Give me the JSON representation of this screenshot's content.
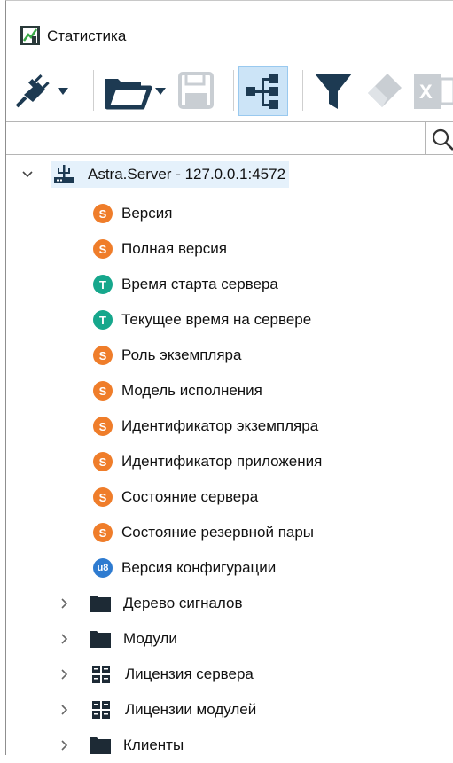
{
  "window": {
    "title": "Статистика"
  },
  "toolbar": {
    "items": [
      "connect-icon",
      "open-folder-icon",
      "save-icon",
      "tree-view-icon",
      "filter-icon",
      "eraser-icon",
      "excel-icon"
    ],
    "active": "tree-view-icon"
  },
  "search": {
    "value": "",
    "placeholder": ""
  },
  "tree": {
    "root": {
      "label": "Astra.Server - 127.0.0.1:4572",
      "expanded": true
    },
    "items": [
      {
        "badge": "S",
        "type": "string",
        "label": "Версия"
      },
      {
        "badge": "S",
        "type": "string",
        "label": "Полная версия"
      },
      {
        "badge": "T",
        "type": "time",
        "label": "Время старта сервера"
      },
      {
        "badge": "T",
        "type": "time",
        "label": "Текущее время на сервере"
      },
      {
        "badge": "S",
        "type": "string",
        "label": "Роль экземпляра"
      },
      {
        "badge": "S",
        "type": "string",
        "label": "Модель исполнения"
      },
      {
        "badge": "S",
        "type": "string",
        "label": "Идентификатор экземпляра"
      },
      {
        "badge": "S",
        "type": "string",
        "label": "Идентификатор приложения"
      },
      {
        "badge": "S",
        "type": "string",
        "label": "Состояние сервера"
      },
      {
        "badge": "S",
        "type": "string",
        "label": "Состояние резервной пары"
      },
      {
        "badge": "u8",
        "type": "uint8",
        "label": "Версия конфигурации"
      }
    ],
    "groups": [
      {
        "icon": "folder-icon",
        "label": "Дерево сигналов"
      },
      {
        "icon": "folder-icon",
        "label": "Модули"
      },
      {
        "icon": "grid-icon",
        "label": "Лицензия сервера"
      },
      {
        "icon": "grid-icon",
        "label": "Лицензии модулей"
      },
      {
        "icon": "folder-icon",
        "label": "Клиенты"
      }
    ]
  },
  "colors": {
    "string_badge": "#ef7d2a",
    "time_badge": "#16a78c",
    "uint8_badge": "#2e7bd0",
    "selection": "#e5f1fb",
    "toolbar_icon": "#1d3a52"
  }
}
